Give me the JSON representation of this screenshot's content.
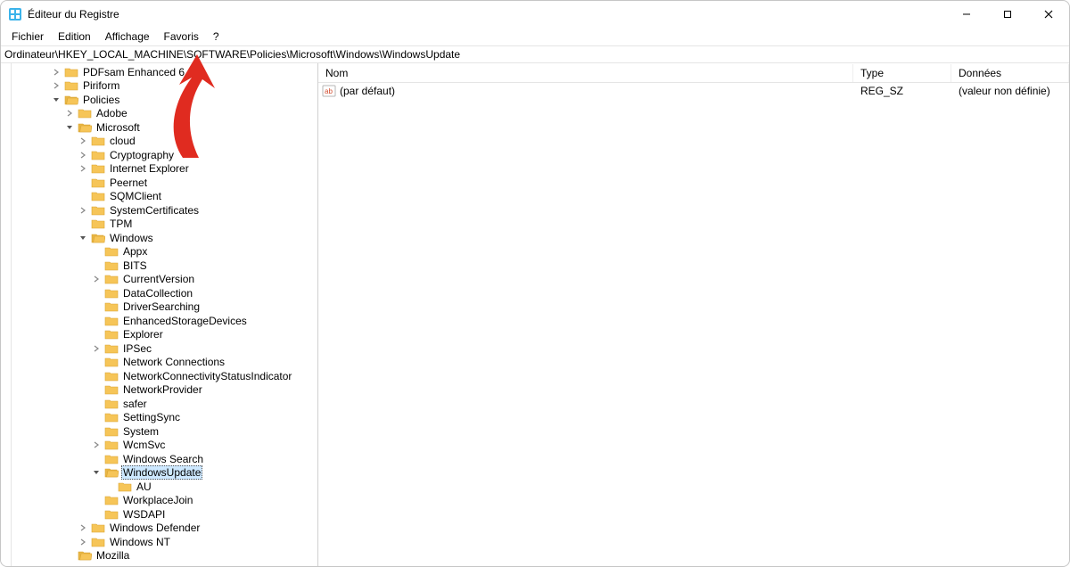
{
  "window": {
    "title": "Éditeur du Registre"
  },
  "menu": {
    "items": [
      "Fichier",
      "Edition",
      "Affichage",
      "Favoris",
      "?"
    ]
  },
  "address": "Ordinateur\\HKEY_LOCAL_MACHINE\\SOFTWARE\\Policies\\Microsoft\\Windows\\WindowsUpdate",
  "tree": [
    {
      "depth": 3,
      "expander": ">",
      "label": "PDFsam Enhanced 6"
    },
    {
      "depth": 3,
      "expander": ">",
      "label": "Piriform"
    },
    {
      "depth": 3,
      "expander": "v",
      "label": "Policies",
      "open": true
    },
    {
      "depth": 4,
      "expander": ">",
      "label": "Adobe"
    },
    {
      "depth": 4,
      "expander": "v",
      "label": "Microsoft",
      "open": true
    },
    {
      "depth": 5,
      "expander": ">",
      "label": "cloud"
    },
    {
      "depth": 5,
      "expander": ">",
      "label": "Cryptography"
    },
    {
      "depth": 5,
      "expander": ">",
      "label": "Internet Explorer"
    },
    {
      "depth": 5,
      "expander": "",
      "label": "Peernet"
    },
    {
      "depth": 5,
      "expander": "",
      "label": "SQMClient"
    },
    {
      "depth": 5,
      "expander": ">",
      "label": "SystemCertificates"
    },
    {
      "depth": 5,
      "expander": "",
      "label": "TPM"
    },
    {
      "depth": 5,
      "expander": "v",
      "label": "Windows",
      "open": true
    },
    {
      "depth": 6,
      "expander": "",
      "label": "Appx"
    },
    {
      "depth": 6,
      "expander": "",
      "label": "BITS"
    },
    {
      "depth": 6,
      "expander": ">",
      "label": "CurrentVersion"
    },
    {
      "depth": 6,
      "expander": "",
      "label": "DataCollection"
    },
    {
      "depth": 6,
      "expander": "",
      "label": "DriverSearching"
    },
    {
      "depth": 6,
      "expander": "",
      "label": "EnhancedStorageDevices"
    },
    {
      "depth": 6,
      "expander": "",
      "label": "Explorer"
    },
    {
      "depth": 6,
      "expander": ">",
      "label": "IPSec"
    },
    {
      "depth": 6,
      "expander": "",
      "label": "Network Connections"
    },
    {
      "depth": 6,
      "expander": "",
      "label": "NetworkConnectivityStatusIndicator"
    },
    {
      "depth": 6,
      "expander": "",
      "label": "NetworkProvider"
    },
    {
      "depth": 6,
      "expander": "",
      "label": "safer"
    },
    {
      "depth": 6,
      "expander": "",
      "label": "SettingSync"
    },
    {
      "depth": 6,
      "expander": "",
      "label": "System"
    },
    {
      "depth": 6,
      "expander": ">",
      "label": "WcmSvc"
    },
    {
      "depth": 6,
      "expander": "",
      "label": "Windows Search"
    },
    {
      "depth": 6,
      "expander": "v",
      "label": "WindowsUpdate",
      "open": true,
      "selected": true
    },
    {
      "depth": 7,
      "expander": "",
      "label": "AU"
    },
    {
      "depth": 6,
      "expander": "",
      "label": "WorkplaceJoin"
    },
    {
      "depth": 6,
      "expander": "",
      "label": "WSDAPI"
    },
    {
      "depth": 5,
      "expander": ">",
      "label": "Windows Defender"
    },
    {
      "depth": 5,
      "expander": ">",
      "label": "Windows NT"
    },
    {
      "depth": 4,
      "expander": "",
      "label": "Mozilla",
      "open": true
    }
  ],
  "list": {
    "headers": {
      "name": "Nom",
      "type": "Type",
      "data": "Données"
    },
    "rows": [
      {
        "icon": "string",
        "name": "(par défaut)",
        "type": "REG_SZ",
        "data": "(valeur non définie)"
      }
    ]
  }
}
